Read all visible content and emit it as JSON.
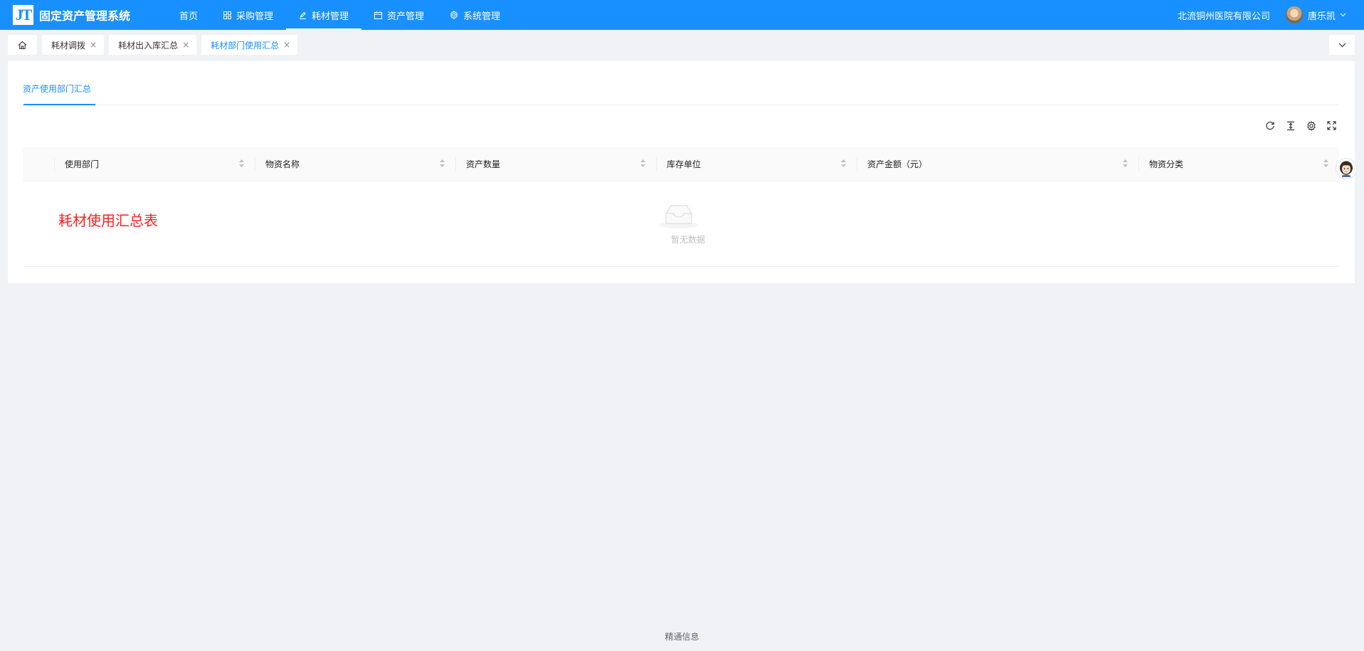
{
  "app": {
    "logo": "JT",
    "title": "固定资产管理系统"
  },
  "nav": {
    "items": [
      {
        "label": "首页"
      },
      {
        "label": "采购管理"
      },
      {
        "label": "耗材管理"
      },
      {
        "label": "资产管理"
      },
      {
        "label": "系统管理"
      }
    ]
  },
  "header": {
    "company": "北流铜州医院有限公司",
    "user": "唐乐凯"
  },
  "tabs": [
    {
      "label": "耗材调拨",
      "close": "×"
    },
    {
      "label": "耗材出入库汇总",
      "close": "×"
    },
    {
      "label": "耗材部门使用汇总",
      "close": "×"
    }
  ],
  "page": {
    "subtab": "资产使用部门汇总",
    "columns": [
      "使用部门",
      "物资名称",
      "资产数量",
      "库存单位",
      "资产金额（元）",
      "物资分类"
    ],
    "empty_text": "暂无数据",
    "note": "耗材使用汇总表"
  },
  "footer": {
    "text": "精通信息"
  },
  "colors": {
    "primary": "#1890ff",
    "note": "#ff1d1d"
  }
}
